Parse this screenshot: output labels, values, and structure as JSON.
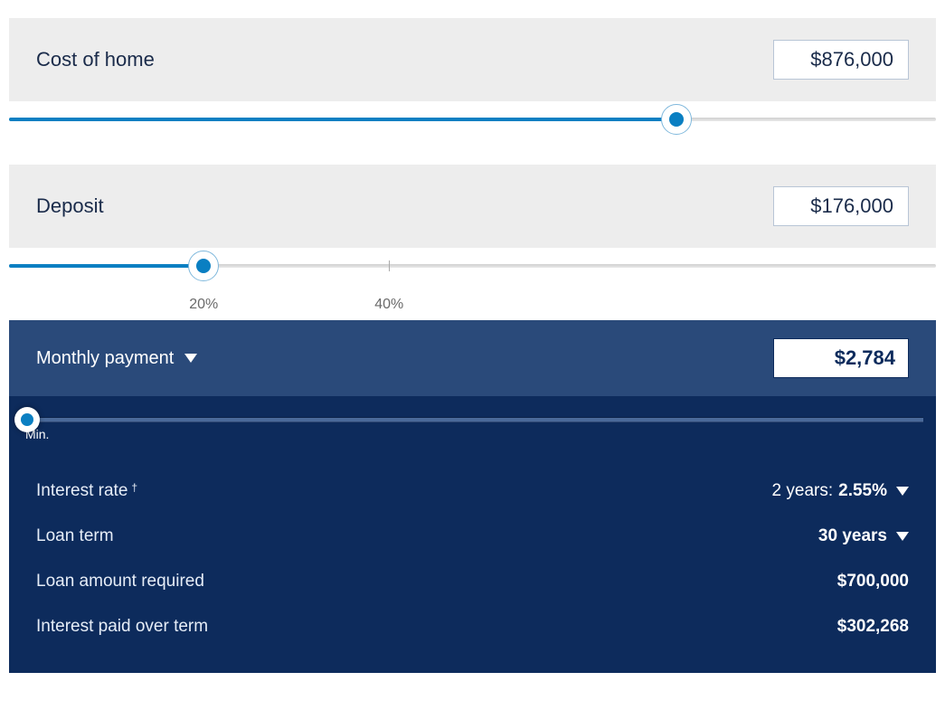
{
  "cost_of_home": {
    "label": "Cost of home",
    "value": "$876,000",
    "slider_percent": 72
  },
  "deposit": {
    "label": "Deposit",
    "value": "$176,000",
    "slider_percent": 21,
    "ticks": [
      {
        "percent": 21,
        "label": "20%"
      },
      {
        "percent": 41,
        "label": "40%"
      }
    ]
  },
  "monthly_payment": {
    "label": "Monthly payment",
    "value": "$2,784",
    "min_label": "Min."
  },
  "details": {
    "interest_rate": {
      "label": "Interest rate",
      "prefix": "2 years:",
      "value": "2.55%"
    },
    "loan_term": {
      "label": "Loan term",
      "value": "30 years"
    },
    "loan_amount": {
      "label": "Loan amount required",
      "value": "$700,000"
    },
    "interest_paid": {
      "label": "Interest paid over term",
      "value": "$302,268"
    }
  }
}
